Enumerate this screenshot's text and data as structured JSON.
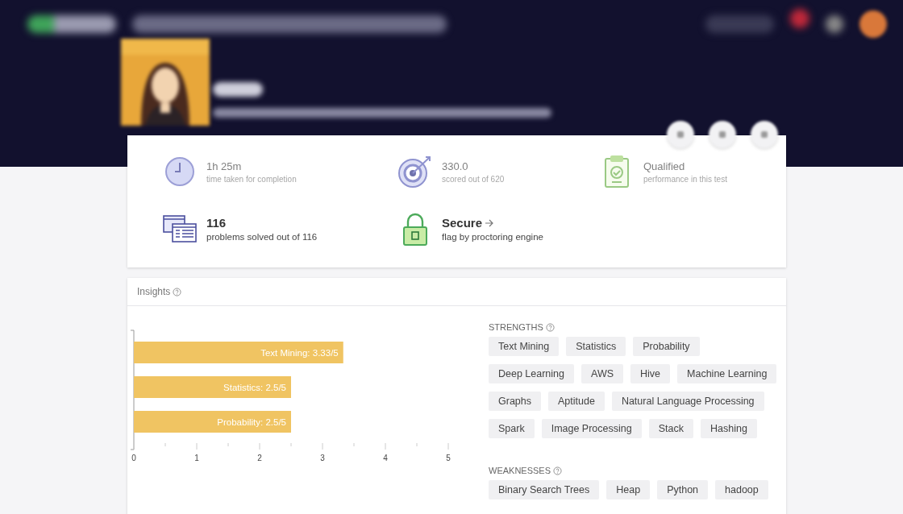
{
  "header": {
    "actions": [
      {
        "kind": "round"
      },
      {
        "kind": "round"
      },
      {
        "kind": "round"
      }
    ]
  },
  "stats": [
    {
      "value": "1h 25m",
      "caption": "time taken for completion",
      "faded": true,
      "arrow": false
    },
    {
      "value": "330.0",
      "caption": "scored out of 620",
      "faded": true,
      "arrow": false
    },
    {
      "value": "Qualified",
      "caption": "performance in this test",
      "faded": true,
      "arrow": false
    },
    {
      "value": "116",
      "caption": "problems solved out of 116",
      "faded": false,
      "arrow": false
    },
    {
      "value": "Secure",
      "caption": "flag by proctoring engine",
      "faded": false,
      "arrow": true
    }
  ],
  "insights": {
    "title": "Insights",
    "chart_data": {
      "type": "bar",
      "orientation": "horizontal",
      "values": [
        3.33,
        2.5,
        2.5
      ],
      "xlim": [
        0,
        5
      ],
      "xticks": [
        0,
        1,
        2,
        3,
        4,
        5
      ],
      "value_labels": [
        "Text Mining: 3.33/5",
        "Statistics: 2.5/5",
        "Probability: 2.5/5"
      ]
    },
    "strengths": {
      "title": "STRENGTHS",
      "rows": [
        [
          "Text Mining",
          "Statistics",
          "Probability"
        ],
        [
          "Deep Learning",
          "AWS",
          "Hive",
          "Machine Learning"
        ],
        [
          "Graphs",
          "Aptitude",
          "Natural Language Processing"
        ],
        [
          "Spark",
          "Image Processing",
          "Stack",
          "Hashing"
        ]
      ]
    },
    "weaknesses": {
      "title": "WEAKNESSES",
      "rows": [
        [
          "Binary Search Trees",
          "Heap",
          "Python",
          "hadoop"
        ]
      ]
    }
  }
}
